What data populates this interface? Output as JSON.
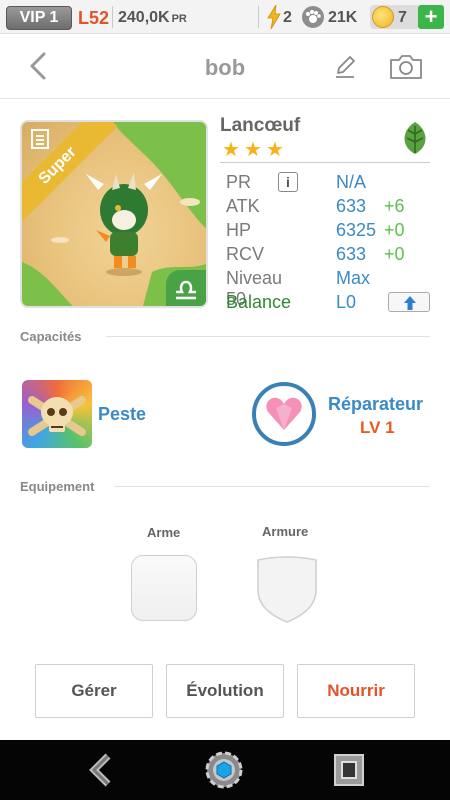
{
  "statusbar": {
    "vip": "VIP 1",
    "level": "L52",
    "power": "240,0K",
    "power_unit": "PR",
    "energy": "2",
    "food": "21K",
    "coins": "7",
    "plus": "+"
  },
  "header": {
    "title": "bob"
  },
  "monster": {
    "name": "Lancœuf",
    "badge": "Super",
    "stars": [
      "★",
      "★",
      "★"
    ],
    "stats": [
      {
        "label": "PR",
        "value": "N/A",
        "bonus": ""
      },
      {
        "label": "ATK",
        "value": "633",
        "bonus": "+6"
      },
      {
        "label": "HP",
        "value": "6325",
        "bonus": "+0"
      },
      {
        "label": "RCV",
        "value": "633",
        "bonus": "+0"
      },
      {
        "label": "Niveau 50",
        "value": "Max",
        "bonus": ""
      },
      {
        "label": "Balance",
        "value": "L0",
        "bonus": ""
      }
    ],
    "info_glyph": "i"
  },
  "sections": {
    "capacites": "Capacités",
    "equipement": "Equipement"
  },
  "skills": {
    "skill1": "Peste",
    "skill2": "Réparateur",
    "skill2_level": "LV 1"
  },
  "equipment": {
    "weapon": "Arme",
    "armor": "Armure"
  },
  "actions": {
    "manage": "Gérer",
    "evolution": "Évolution",
    "feed": "Nourrir"
  },
  "colors": {
    "accent_blue": "#3a8ac8",
    "bonus_green": "#5cc24c",
    "action_orange": "#e2532a"
  }
}
